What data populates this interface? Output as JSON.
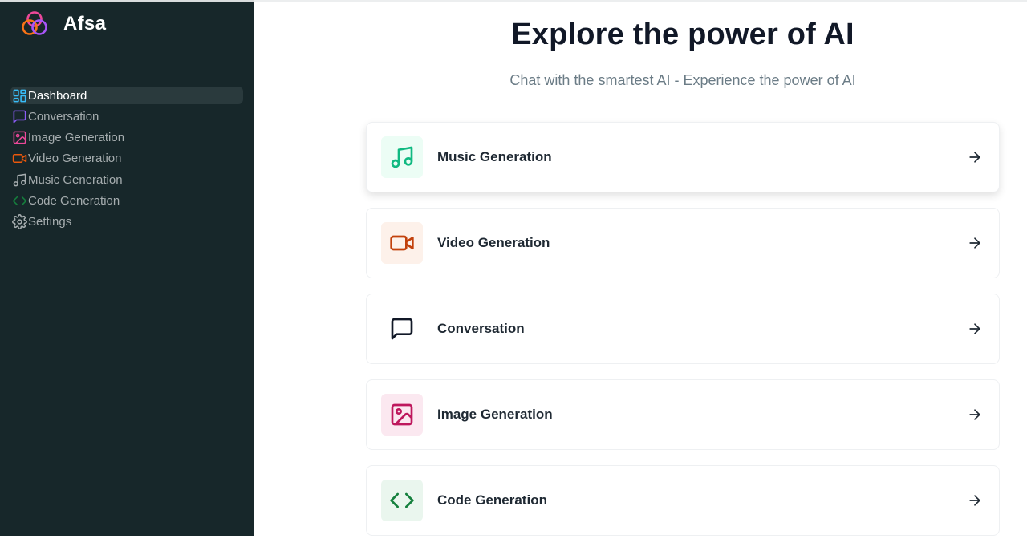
{
  "app": {
    "name": "Afsa"
  },
  "sidebar": {
    "items": [
      {
        "label": "Dashboard",
        "icon": "layout-dashboard-icon",
        "color": "#38bdf8",
        "active": true
      },
      {
        "label": "Conversation",
        "icon": "message-square-icon",
        "color": "#8b5cf6"
      },
      {
        "label": "Image Generation",
        "icon": "image-icon",
        "color": "#ec4899"
      },
      {
        "label": "Video Generation",
        "icon": "video-icon",
        "color": "#ea580c"
      },
      {
        "label": "Music Generation",
        "icon": "music-icon",
        "color": "#a6adaf"
      },
      {
        "label": "Code Generation",
        "icon": "code-icon",
        "color": "#15803d"
      },
      {
        "label": "Settings",
        "icon": "settings-icon",
        "color": "#a6adaf"
      }
    ]
  },
  "main": {
    "title": "Explore the power of AI",
    "subtitle": "Chat with the smartest AI - Experience the power of AI",
    "cards": [
      {
        "label": "Music Generation",
        "icon": "music-icon",
        "color": "#10b981",
        "bg": "#ecfdf5"
      },
      {
        "label": "Video Generation",
        "icon": "video-icon",
        "color": "#c2410c",
        "bg": "#fdf1ea"
      },
      {
        "label": "Conversation",
        "icon": "message-square-icon",
        "color": "#111827",
        "bg": "#ffffff"
      },
      {
        "label": "Image Generation",
        "icon": "image-icon",
        "color": "#be185d",
        "bg": "#fbe8f0"
      },
      {
        "label": "Code Generation",
        "icon": "code-icon",
        "color": "#15803d",
        "bg": "#eaf6ee"
      }
    ]
  }
}
